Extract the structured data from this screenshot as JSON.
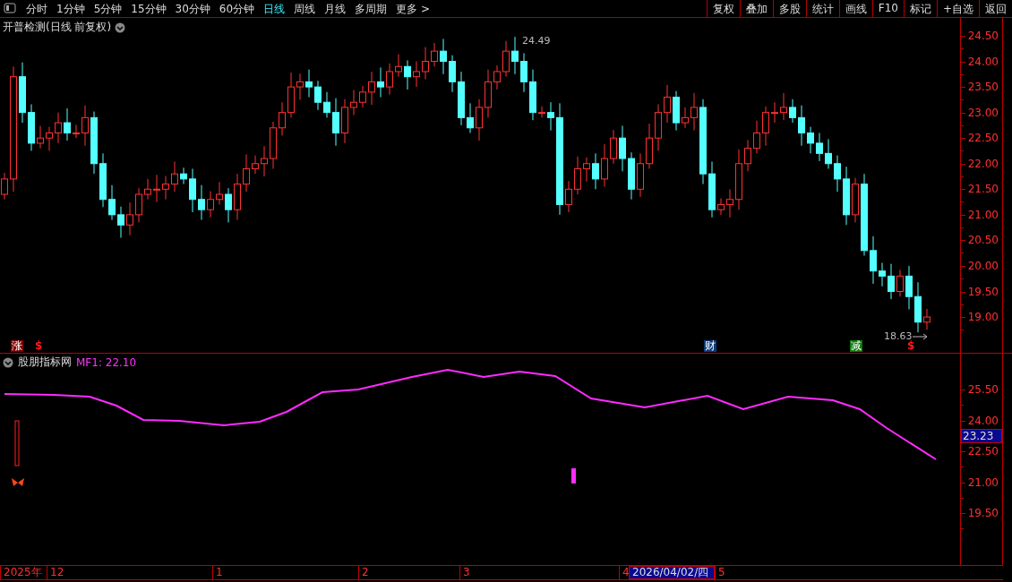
{
  "toolbar": {
    "periods": [
      {
        "label": "分时",
        "selected": false
      },
      {
        "label": "1分钟",
        "selected": false
      },
      {
        "label": "5分钟",
        "selected": false
      },
      {
        "label": "15分钟",
        "selected": false
      },
      {
        "label": "30分钟",
        "selected": false
      },
      {
        "label": "60分钟",
        "selected": false
      },
      {
        "label": "日线",
        "selected": true
      },
      {
        "label": "周线",
        "selected": false
      },
      {
        "label": "月线",
        "selected": false
      },
      {
        "label": "多周期",
        "selected": false
      },
      {
        "label": "更多 >",
        "selected": false
      }
    ],
    "actions": [
      "复权",
      "叠加",
      "多股",
      "统计",
      "画线",
      "F10",
      "标记",
      "+自选",
      "返回"
    ]
  },
  "main_panel": {
    "title": "开普检测(日线 前复权)",
    "high_label": "24.49",
    "low_label": "18.63",
    "axis_labels": [
      "24.50",
      "24.00",
      "23.50",
      "23.00",
      "22.50",
      "22.00",
      "21.50",
      "21.00",
      "20.50",
      "20.00",
      "19.50",
      "19.00"
    ],
    "markers": [
      {
        "kind": "badge",
        "text": "涨",
        "color": "#800000"
      },
      {
        "kind": "dollar",
        "text": "$"
      },
      {
        "kind": "badge",
        "text": "财",
        "color": "#0a3a78"
      },
      {
        "kind": "badge",
        "text": "减",
        "color": "#0a7a0a"
      },
      {
        "kind": "dollar",
        "text": "$"
      }
    ]
  },
  "indicator_panel": {
    "title": "股朋指标网",
    "reading": "MF1: 22.10",
    "axis_labels": [
      "25.50",
      "24.00",
      "22.50",
      "21.00",
      "19.50"
    ],
    "current_value": "23.23"
  },
  "date_axis": {
    "labels": [
      "2025年",
      "12",
      "1",
      "2",
      "3",
      "4",
      "2026/04/02/四",
      "5"
    ]
  }
}
